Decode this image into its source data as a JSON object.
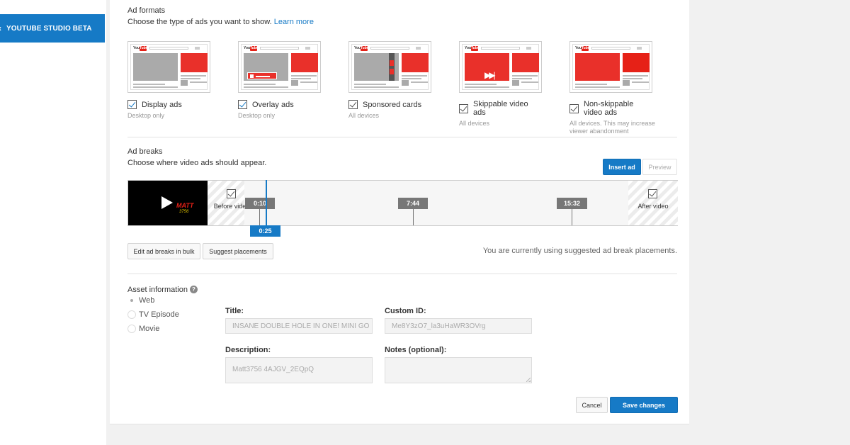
{
  "sidebar": {
    "studio_button": "YOUTUBE STUDIO BETA"
  },
  "ad_formats": {
    "title": "Ad formats",
    "subtitle": "Choose the type of ads you want to show.",
    "learn_more": "Learn more",
    "items": [
      {
        "label": "Display ads",
        "desc": "Desktop only",
        "checked": true
      },
      {
        "label": "Overlay ads",
        "desc": "Desktop only",
        "checked": true
      },
      {
        "label": "Sponsored cards",
        "desc": "All devices",
        "checked": true
      },
      {
        "label": "Skippable video ads",
        "desc": "All devices",
        "checked": true
      },
      {
        "label": "Non-skippable video ads",
        "desc": "All devices. This may increase viewer abandonment",
        "checked": true
      }
    ]
  },
  "ad_breaks": {
    "title": "Ad breaks",
    "subtitle": "Choose where video ads should appear.",
    "insert_ad": "Insert ad",
    "preview": "Preview",
    "thumbnail_logo": "MATT",
    "thumbnail_logo_sub": "3756",
    "before_video": "Before video",
    "after_video": "After video",
    "markers": [
      "0:10",
      "7:44",
      "15:32"
    ],
    "playhead": "0:25",
    "edit_bulk": "Edit ad breaks in bulk",
    "suggest": "Suggest placements",
    "note": "You are currently using suggested ad break placements."
  },
  "asset": {
    "title": "Asset information",
    "help_icon": "?",
    "options": [
      "Web",
      "TV Episode",
      "Movie"
    ],
    "selected": "Web",
    "title_label": "Title:",
    "title_value": "INSANE DOUBLE HOLE IN ONE! MINI GO",
    "custom_id_label": "Custom ID:",
    "custom_id_value": "Me8Y3zO7_la3uHaWR3OVrg",
    "description_label": "Description:",
    "description_value": "Matt3756 4AJGV_2EQpQ",
    "notes_label": "Notes (optional):",
    "notes_value": ""
  },
  "footer": {
    "cancel": "Cancel",
    "save": "Save changes"
  },
  "colors": {
    "accent": "#167ac6",
    "ad_red": "#e9302a"
  }
}
